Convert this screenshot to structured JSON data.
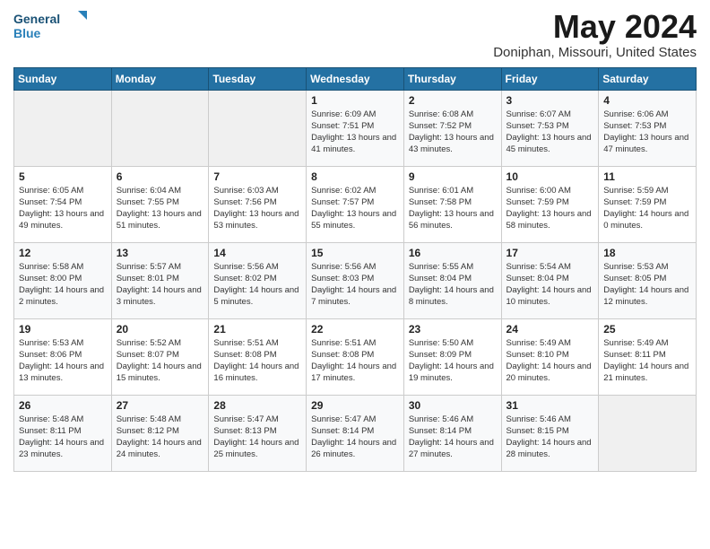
{
  "header": {
    "logo_line1": "General",
    "logo_line2": "Blue",
    "month": "May 2024",
    "location": "Doniphan, Missouri, United States"
  },
  "weekdays": [
    "Sunday",
    "Monday",
    "Tuesday",
    "Wednesday",
    "Thursday",
    "Friday",
    "Saturday"
  ],
  "weeks": [
    [
      {
        "day": "",
        "empty": true
      },
      {
        "day": "",
        "empty": true
      },
      {
        "day": "",
        "empty": true
      },
      {
        "day": "1",
        "sunrise": "6:09 AM",
        "sunset": "7:51 PM",
        "daylight": "13 hours and 41 minutes."
      },
      {
        "day": "2",
        "sunrise": "6:08 AM",
        "sunset": "7:52 PM",
        "daylight": "13 hours and 43 minutes."
      },
      {
        "day": "3",
        "sunrise": "6:07 AM",
        "sunset": "7:53 PM",
        "daylight": "13 hours and 45 minutes."
      },
      {
        "day": "4",
        "sunrise": "6:06 AM",
        "sunset": "7:53 PM",
        "daylight": "13 hours and 47 minutes."
      }
    ],
    [
      {
        "day": "5",
        "sunrise": "6:05 AM",
        "sunset": "7:54 PM",
        "daylight": "13 hours and 49 minutes."
      },
      {
        "day": "6",
        "sunrise": "6:04 AM",
        "sunset": "7:55 PM",
        "daylight": "13 hours and 51 minutes."
      },
      {
        "day": "7",
        "sunrise": "6:03 AM",
        "sunset": "7:56 PM",
        "daylight": "13 hours and 53 minutes."
      },
      {
        "day": "8",
        "sunrise": "6:02 AM",
        "sunset": "7:57 PM",
        "daylight": "13 hours and 55 minutes."
      },
      {
        "day": "9",
        "sunrise": "6:01 AM",
        "sunset": "7:58 PM",
        "daylight": "13 hours and 56 minutes."
      },
      {
        "day": "10",
        "sunrise": "6:00 AM",
        "sunset": "7:59 PM",
        "daylight": "13 hours and 58 minutes."
      },
      {
        "day": "11",
        "sunrise": "5:59 AM",
        "sunset": "7:59 PM",
        "daylight": "14 hours and 0 minutes."
      }
    ],
    [
      {
        "day": "12",
        "sunrise": "5:58 AM",
        "sunset": "8:00 PM",
        "daylight": "14 hours and 2 minutes."
      },
      {
        "day": "13",
        "sunrise": "5:57 AM",
        "sunset": "8:01 PM",
        "daylight": "14 hours and 3 minutes."
      },
      {
        "day": "14",
        "sunrise": "5:56 AM",
        "sunset": "8:02 PM",
        "daylight": "14 hours and 5 minutes."
      },
      {
        "day": "15",
        "sunrise": "5:56 AM",
        "sunset": "8:03 PM",
        "daylight": "14 hours and 7 minutes."
      },
      {
        "day": "16",
        "sunrise": "5:55 AM",
        "sunset": "8:04 PM",
        "daylight": "14 hours and 8 minutes."
      },
      {
        "day": "17",
        "sunrise": "5:54 AM",
        "sunset": "8:04 PM",
        "daylight": "14 hours and 10 minutes."
      },
      {
        "day": "18",
        "sunrise": "5:53 AM",
        "sunset": "8:05 PM",
        "daylight": "14 hours and 12 minutes."
      }
    ],
    [
      {
        "day": "19",
        "sunrise": "5:53 AM",
        "sunset": "8:06 PM",
        "daylight": "14 hours and 13 minutes."
      },
      {
        "day": "20",
        "sunrise": "5:52 AM",
        "sunset": "8:07 PM",
        "daylight": "14 hours and 15 minutes."
      },
      {
        "day": "21",
        "sunrise": "5:51 AM",
        "sunset": "8:08 PM",
        "daylight": "14 hours and 16 minutes."
      },
      {
        "day": "22",
        "sunrise": "5:51 AM",
        "sunset": "8:08 PM",
        "daylight": "14 hours and 17 minutes."
      },
      {
        "day": "23",
        "sunrise": "5:50 AM",
        "sunset": "8:09 PM",
        "daylight": "14 hours and 19 minutes."
      },
      {
        "day": "24",
        "sunrise": "5:49 AM",
        "sunset": "8:10 PM",
        "daylight": "14 hours and 20 minutes."
      },
      {
        "day": "25",
        "sunrise": "5:49 AM",
        "sunset": "8:11 PM",
        "daylight": "14 hours and 21 minutes."
      }
    ],
    [
      {
        "day": "26",
        "sunrise": "5:48 AM",
        "sunset": "8:11 PM",
        "daylight": "14 hours and 23 minutes."
      },
      {
        "day": "27",
        "sunrise": "5:48 AM",
        "sunset": "8:12 PM",
        "daylight": "14 hours and 24 minutes."
      },
      {
        "day": "28",
        "sunrise": "5:47 AM",
        "sunset": "8:13 PM",
        "daylight": "14 hours and 25 minutes."
      },
      {
        "day": "29",
        "sunrise": "5:47 AM",
        "sunset": "8:14 PM",
        "daylight": "14 hours and 26 minutes."
      },
      {
        "day": "30",
        "sunrise": "5:46 AM",
        "sunset": "8:14 PM",
        "daylight": "14 hours and 27 minutes."
      },
      {
        "day": "31",
        "sunrise": "5:46 AM",
        "sunset": "8:15 PM",
        "daylight": "14 hours and 28 minutes."
      },
      {
        "day": "",
        "empty": true
      }
    ]
  ]
}
